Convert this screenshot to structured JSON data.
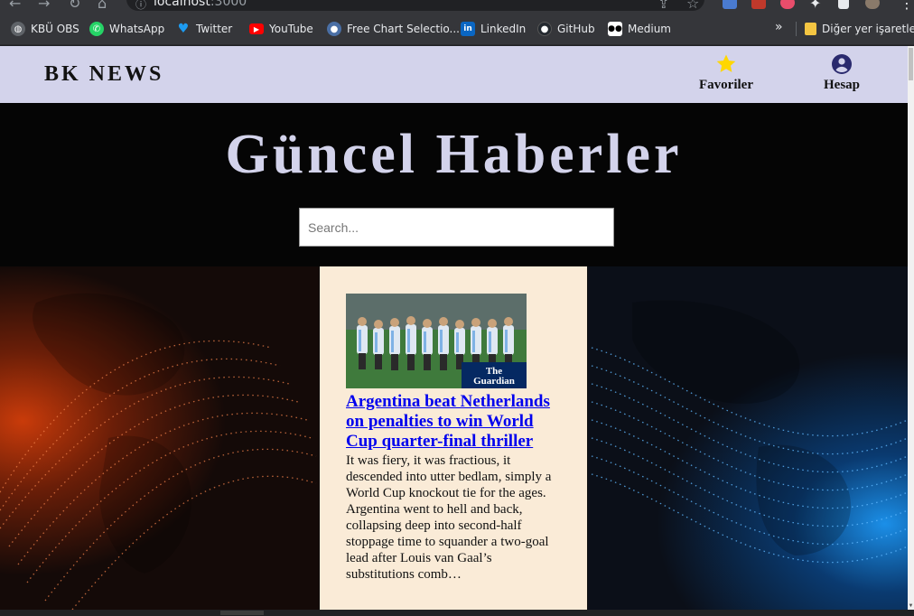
{
  "browser": {
    "url_host": "localhost",
    "url_port": ":3000",
    "bookmarks": [
      {
        "label": "KBÜ OBS",
        "icon": "globe-icon",
        "color": "#5f6368"
      },
      {
        "label": "WhatsApp",
        "icon": "whatsapp-icon",
        "color": "#25d366"
      },
      {
        "label": "Twitter",
        "icon": "twitter-icon",
        "color": "#1d9bf0"
      },
      {
        "label": "YouTube",
        "icon": "youtube-icon",
        "color": "#ff0000"
      },
      {
        "label": "Free Chart Selectio...",
        "icon": "chart-site-icon",
        "color": "#4a6fa5"
      },
      {
        "label": "LinkedIn",
        "icon": "linkedin-icon",
        "color": "#0a66c2"
      },
      {
        "label": "GitHub",
        "icon": "github-icon",
        "color": "#24292f"
      },
      {
        "label": "Medium",
        "icon": "medium-icon",
        "color": "#000000"
      }
    ],
    "more_label": "»",
    "other_bookmarks": "Diğer yer işaretleri"
  },
  "navbar": {
    "logo": "BK NEWS",
    "favorites_label": "Favoriler",
    "account_label": "Hesap"
  },
  "hero": {
    "title": "Güncel Haberler",
    "search_placeholder": "Search..."
  },
  "articles": [
    {
      "title": "Argentina beat Netherlands on penalties to win World Cup quarter-final thriller",
      "description": "It was fiery, it was fractious, it descended into utter bedlam, simply a World Cup knockout tie for the ages. Argentina went to hell and back, collapsing deep into second-half stoppage time to squander a two-goal lead after Louis van Gaal’s substitutions comb…",
      "image_badge": "The Guardian"
    }
  ],
  "colors": {
    "navbar_bg": "#d3d3eb",
    "hero_bg": "#050505",
    "card_bg": "#faebd7",
    "link": "#0000ee",
    "favorite_star": "#ffd700",
    "account_icon": "#2a2a6e"
  }
}
